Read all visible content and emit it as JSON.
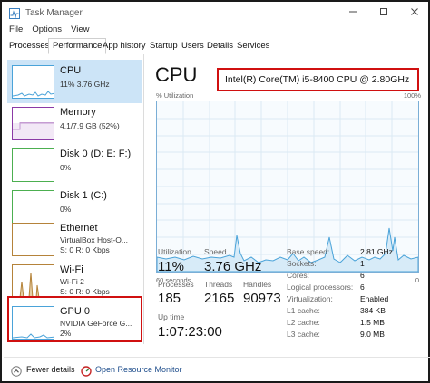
{
  "window": {
    "title": "Task Manager",
    "min_icon": "minimize-icon",
    "max_icon": "maximize-icon",
    "close_icon": "close-icon"
  },
  "menu": {
    "items": [
      "File",
      "Options",
      "View"
    ]
  },
  "tabs": [
    "Processes",
    "Performance",
    "App history",
    "Startup",
    "Users",
    "Details",
    "Services"
  ],
  "active_tab": "Performance",
  "sidebar": {
    "items": [
      {
        "title": "CPU",
        "sub1": "11% 3.76 GHz",
        "sub2": "",
        "color": "#4aa3d9"
      },
      {
        "title": "Memory",
        "sub1": "4.1/7.9 GB (52%)",
        "sub2": "",
        "color": "#8b3aa6"
      },
      {
        "title": "Disk 0 (D: E: F:)",
        "sub1": "0%",
        "sub2": "",
        "color": "#4caf50"
      },
      {
        "title": "Disk 1 (C:)",
        "sub1": "0%",
        "sub2": "",
        "color": "#4caf50"
      },
      {
        "title": "Ethernet",
        "sub1": "VirtualBox Host-O...",
        "sub2": "S: 0 R: 0 Kbps",
        "color": "#b5833a"
      },
      {
        "title": "Wi-Fi",
        "sub1": "Wi-Fi 2",
        "sub2": "S: 0 R: 0 Kbps",
        "color": "#b5833a"
      },
      {
        "title": "GPU 0",
        "sub1": "NVIDIA GeForce G...",
        "sub2": "2%",
        "color": "#4aa3d9"
      }
    ]
  },
  "main": {
    "title": "CPU",
    "cpu_name": "Intel(R) Core(TM) i5-8400 CPU @ 2.80GHz",
    "util_label": "% Utilization",
    "util_max": "100%",
    "axis_left": "60 seconds",
    "axis_right": "0",
    "stats": {
      "utilization_label": "Utilization",
      "utilization_value": "11%",
      "speed_label": "Speed",
      "speed_value": "3.76 GHz",
      "processes_label": "Processes",
      "processes_value": "185",
      "threads_label": "Threads",
      "threads_value": "2165",
      "handles_label": "Handles",
      "handles_value": "90973",
      "uptime_label": "Up time",
      "uptime_value": "1:07:23:00"
    },
    "specs": [
      {
        "label": "Base speed:",
        "value": "2.81 GHz"
      },
      {
        "label": "Sockets:",
        "value": "1"
      },
      {
        "label": "Cores:",
        "value": "6"
      },
      {
        "label": "Logical processors:",
        "value": "6"
      },
      {
        "label": "Virtualization:",
        "value": "Enabled"
      },
      {
        "label": "L1 cache:",
        "value": "384 KB"
      },
      {
        "label": "L2 cache:",
        "value": "1.5 MB"
      },
      {
        "label": "L3 cache:",
        "value": "9.0 MB"
      }
    ]
  },
  "footer": {
    "fewer_details": "Fewer details",
    "open_monitor": "Open Resource Monitor"
  },
  "colors": {
    "accent": "#4aa3d9",
    "highlight": "#d01010",
    "selected_bg": "#cce4f7"
  }
}
